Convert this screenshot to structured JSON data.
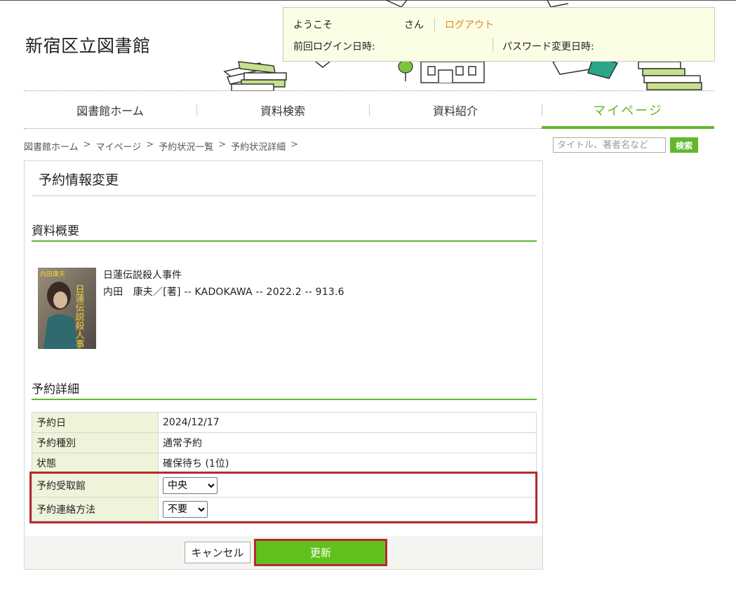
{
  "header": {
    "site_title": "新宿区立図書館",
    "welcome": "ようこそ",
    "san": "さん",
    "logout": "ログアウト",
    "last_login": "前回ログイン日時:",
    "password_changed": "パスワード変更日時:"
  },
  "nav": {
    "items": [
      "図書館ホーム",
      "資料検索",
      "資料紹介",
      "マイページ"
    ],
    "active": "マイページ"
  },
  "breadcrumb": [
    "図書館ホーム",
    "マイページ",
    "予約状況一覧",
    "予約状況詳細"
  ],
  "breadcrumb_sep": ">",
  "side_search": {
    "placeholder": "タイトル、著者名など",
    "button": "検索"
  },
  "panel": {
    "title": "予約情報変更",
    "section_overview": "資料概要",
    "section_detail": "予約詳細"
  },
  "book": {
    "title": "日蓮伝説殺人事件",
    "meta": "内田　康夫／[著] -- KADOKAWA -- 2022.2 -- 913.6",
    "cover_author": "内田康夫",
    "cover_title": "日蓮伝説殺人事件"
  },
  "detail_rows": [
    {
      "label": "予約日",
      "value": "2024/12/17"
    },
    {
      "label": "予約種別",
      "value": "通常予約"
    },
    {
      "label": "状態",
      "value": "確保待ち (1位)"
    }
  ],
  "pickup": {
    "label": "予約受取館",
    "selected": "中央"
  },
  "contact": {
    "label": "予約連絡方法",
    "selected": "不要"
  },
  "buttons": {
    "cancel": "キャンセル",
    "update": "更新"
  },
  "colors": {
    "accent_green": "#62b82a",
    "highlight_red": "#b52a2e",
    "logout_orange": "#e58a1c",
    "label_bg": "#eff3da"
  }
}
